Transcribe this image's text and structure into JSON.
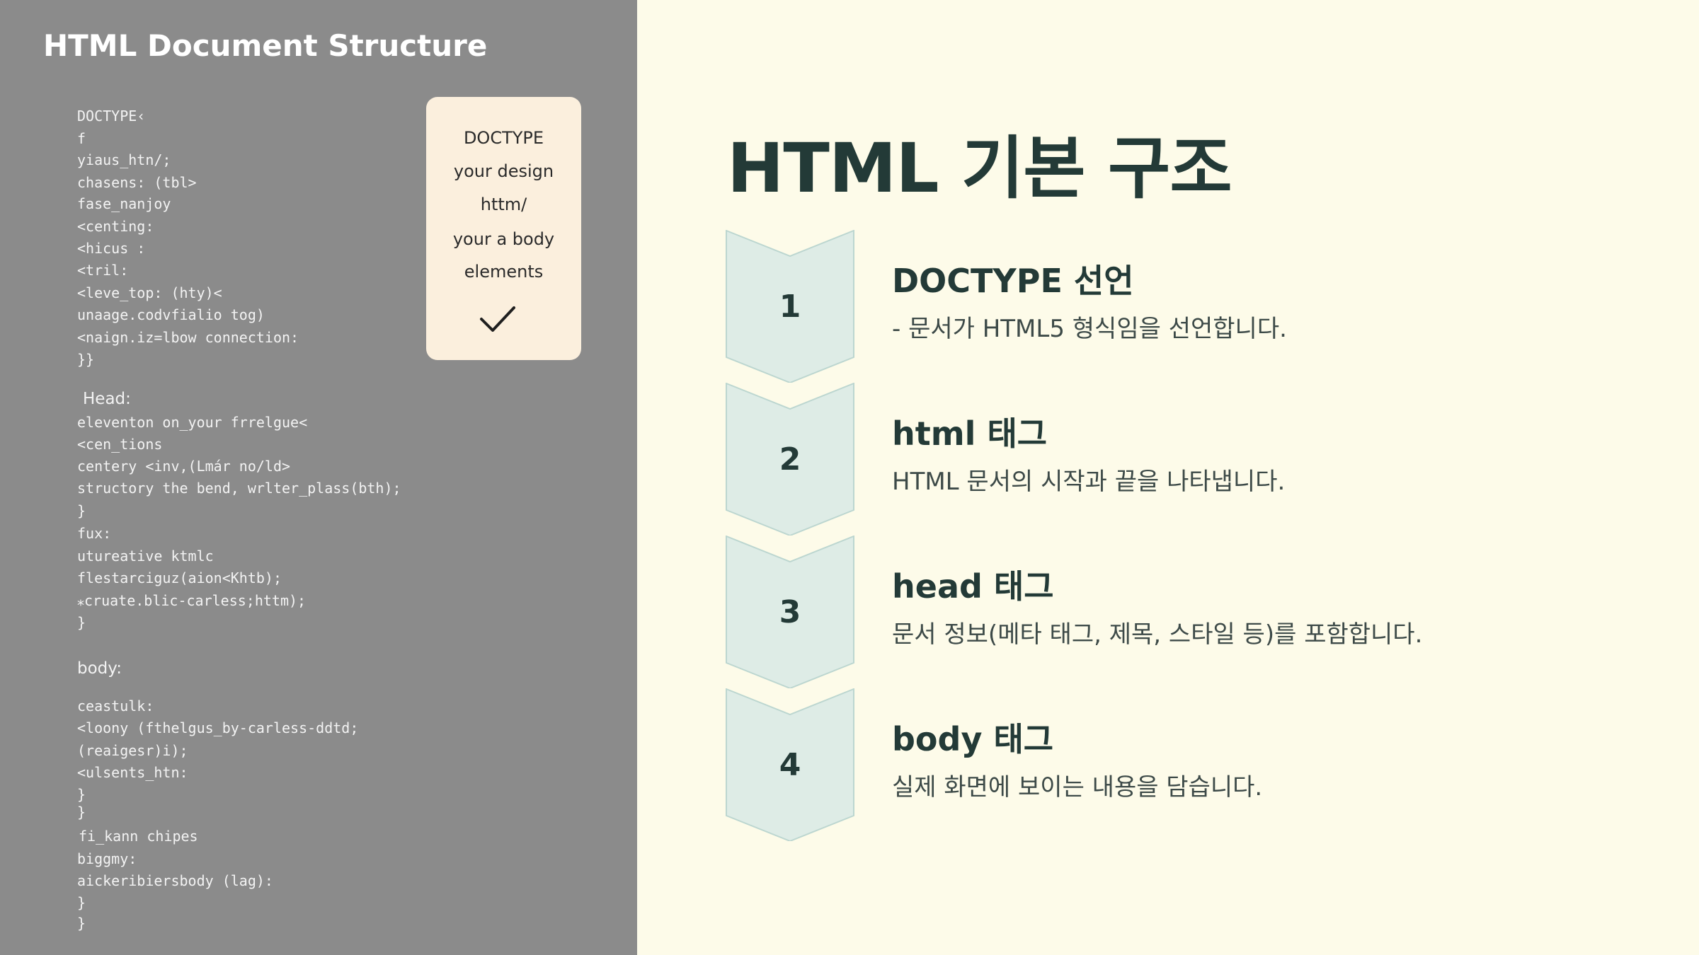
{
  "left_panel": {
    "title": "HTML Document Structure",
    "code_lines": [
      "DOCTYPE‹",
      "  f",
      "    yiaus_htn/;",
      "    chasens: (tbl>",
      "      fase_nanjoy",
      "      <centing:",
      "    <hicus :",
      "  <tril:",
      "    <leve_top: (hty)<",
      "    unaage.codvfialio tog)",
      "    <naign.iz=lbow connection:",
      "  }}",
      "Head:",
      "    eleventon on_your frrelgue<",
      "     <cen_tions",
      "       centery <inv,(Lmár no/ld>",
      "     structory the bend, wrlter_plass(bth);",
      "  }",
      "  fux:",
      "    utureative ktmlc",
      "      flestarciguz(aion<Khtb);",
      "     ⁎cruate.blic-carless;httm);",
      "  }",
      "body:",
      "    ceastulk:",
      "    <loony (fthelgus_by-carless-ddtd;",
      "      (reaigesr)i);",
      "    <ulsents_htn:",
      "     }",
      "  }",
      "fi_kann chipes",
      "    biggmy:",
      "    aickeribiersbody (lag):",
      "  }",
      "}"
    ],
    "card": {
      "lines": [
        "DOCTYPE",
        "your design",
        "httm/",
        "your a body",
        "elements"
      ],
      "icon": "check-icon"
    }
  },
  "main": {
    "title": "HTML 기본 구조",
    "steps": [
      {
        "number": "1",
        "title": "DOCTYPE 선언",
        "description": "- 문서가 HTML5 형식임을 선언합니다."
      },
      {
        "number": "2",
        "title": "html 태그",
        "description": "HTML 문서의 시작과 끝을 나타냅니다."
      },
      {
        "number": "3",
        "title": "head 태그",
        "description": "문서 정보(메타 태그, 제목, 스타일 등)를 포함합니다."
      },
      {
        "number": "4",
        "title": "body 태그",
        "description": "실제 화면에 보이는 내용을 담습니다."
      }
    ]
  },
  "colors": {
    "background": "#fdfbe9",
    "left_panel": "#8b8b8b",
    "chevron_fill": "#deece6",
    "chevron_stroke": "#bcd6d0",
    "heading": "#233a37",
    "card": "#fbefdd"
  }
}
